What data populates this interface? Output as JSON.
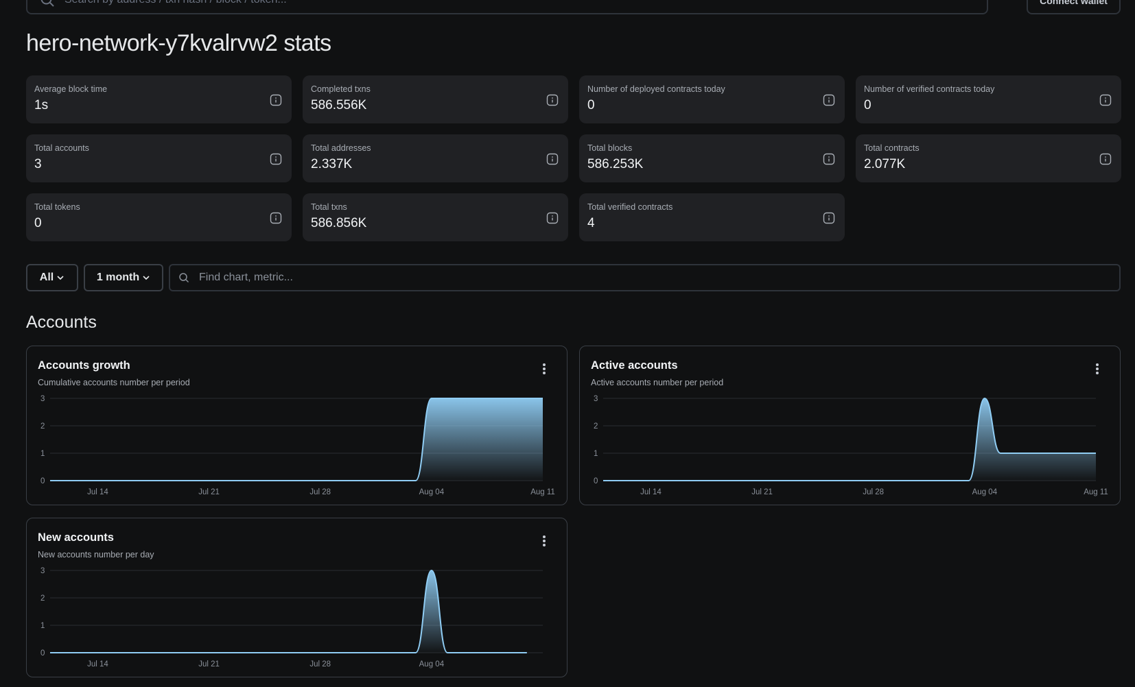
{
  "header": {
    "search_placeholder": "Search by address / txn hash / block / token...",
    "connect_wallet": "Connect wallet"
  },
  "page_title": "hero-network-y7kvalrvw2 stats",
  "stats": [
    {
      "label": "Average block time",
      "value": "1s"
    },
    {
      "label": "Completed txns",
      "value": "586.556K"
    },
    {
      "label": "Number of deployed contracts today",
      "value": "0"
    },
    {
      "label": "Number of verified contracts today",
      "value": "0"
    },
    {
      "label": "Total accounts",
      "value": "3"
    },
    {
      "label": "Total addresses",
      "value": "2.337K"
    },
    {
      "label": "Total blocks",
      "value": "586.253K"
    },
    {
      "label": "Total contracts",
      "value": "2.077K"
    },
    {
      "label": "Total tokens",
      "value": "0"
    },
    {
      "label": "Total txns",
      "value": "586.856K"
    },
    {
      "label": "Total verified contracts",
      "value": "4"
    }
  ],
  "filters": {
    "section": "All",
    "interval": "1 month",
    "find_placeholder": "Find chart, metric..."
  },
  "section_title": "Accounts",
  "colors": {
    "line": "#90cdf4",
    "background": "#101112",
    "card": "#202124"
  },
  "chart_data": [
    {
      "type": "area",
      "title": "Accounts growth",
      "subtitle": "Cumulative accounts number per period",
      "ylim": [
        0,
        3
      ],
      "yticks": [
        "0",
        "1",
        "2",
        "3"
      ],
      "xticks": [
        "Jul 14",
        "Jul 21",
        "Jul 28",
        "Aug 04",
        "Aug 11"
      ],
      "x": [
        "Jul 11",
        "Jul 12",
        "Jul 13",
        "Jul 14",
        "Jul 15",
        "Jul 16",
        "Jul 17",
        "Jul 18",
        "Jul 19",
        "Jul 20",
        "Jul 21",
        "Jul 22",
        "Jul 23",
        "Jul 24",
        "Jul 25",
        "Jul 26",
        "Jul 27",
        "Jul 28",
        "Jul 29",
        "Jul 30",
        "Jul 31",
        "Aug 01",
        "Aug 02",
        "Aug 03",
        "Aug 04",
        "Aug 05",
        "Aug 06",
        "Aug 07",
        "Aug 08",
        "Aug 09",
        "Aug 10",
        "Aug 11"
      ],
      "values": [
        0,
        0,
        0,
        0,
        0,
        0,
        0,
        0,
        0,
        0,
        0,
        0,
        0,
        0,
        0,
        0,
        0,
        0,
        0,
        0,
        0,
        0,
        0,
        0,
        3,
        3,
        3,
        3,
        3,
        3,
        3,
        3
      ],
      "grid": true
    },
    {
      "type": "area",
      "title": "Active accounts",
      "subtitle": "Active accounts number per period",
      "ylim": [
        0,
        3
      ],
      "yticks": [
        "0",
        "1",
        "2",
        "3"
      ],
      "xticks": [
        "Jul 14",
        "Jul 21",
        "Jul 28",
        "Aug 04",
        "Aug 11"
      ],
      "x": [
        "Jul 11",
        "Jul 12",
        "Jul 13",
        "Jul 14",
        "Jul 15",
        "Jul 16",
        "Jul 17",
        "Jul 18",
        "Jul 19",
        "Jul 20",
        "Jul 21",
        "Jul 22",
        "Jul 23",
        "Jul 24",
        "Jul 25",
        "Jul 26",
        "Jul 27",
        "Jul 28",
        "Jul 29",
        "Jul 30",
        "Jul 31",
        "Aug 01",
        "Aug 02",
        "Aug 03",
        "Aug 04",
        "Aug 05",
        "Aug 06",
        "Aug 07",
        "Aug 08",
        "Aug 09",
        "Aug 10",
        "Aug 11"
      ],
      "values": [
        0,
        0,
        0,
        0,
        0,
        0,
        0,
        0,
        0,
        0,
        0,
        0,
        0,
        0,
        0,
        0,
        0,
        0,
        0,
        0,
        0,
        0,
        0,
        0,
        3,
        1,
        1,
        1,
        1,
        1,
        1,
        1
      ],
      "grid": true
    },
    {
      "type": "area",
      "title": "New accounts",
      "subtitle": "New accounts number per day",
      "ylim": [
        0,
        3
      ],
      "yticks": [
        "0",
        "1",
        "2",
        "3"
      ],
      "xticks": [
        "Jul 14",
        "Jul 21",
        "Jul 28",
        "Aug 04"
      ],
      "x": [
        "Jul 11",
        "Jul 12",
        "Jul 13",
        "Jul 14",
        "Jul 15",
        "Jul 16",
        "Jul 17",
        "Jul 18",
        "Jul 19",
        "Jul 20",
        "Jul 21",
        "Jul 22",
        "Jul 23",
        "Jul 24",
        "Jul 25",
        "Jul 26",
        "Jul 27",
        "Jul 28",
        "Jul 29",
        "Jul 30",
        "Jul 31",
        "Aug 01",
        "Aug 02",
        "Aug 03",
        "Aug 04",
        "Aug 05",
        "Aug 06",
        "Aug 07",
        "Aug 08",
        "Aug 09",
        "Aug 10"
      ],
      "values": [
        0,
        0,
        0,
        0,
        0,
        0,
        0,
        0,
        0,
        0,
        0,
        0,
        0,
        0,
        0,
        0,
        0,
        0,
        0,
        0,
        0,
        0,
        0,
        0,
        3,
        0,
        0,
        0,
        0,
        0,
        0
      ],
      "grid": true
    }
  ]
}
